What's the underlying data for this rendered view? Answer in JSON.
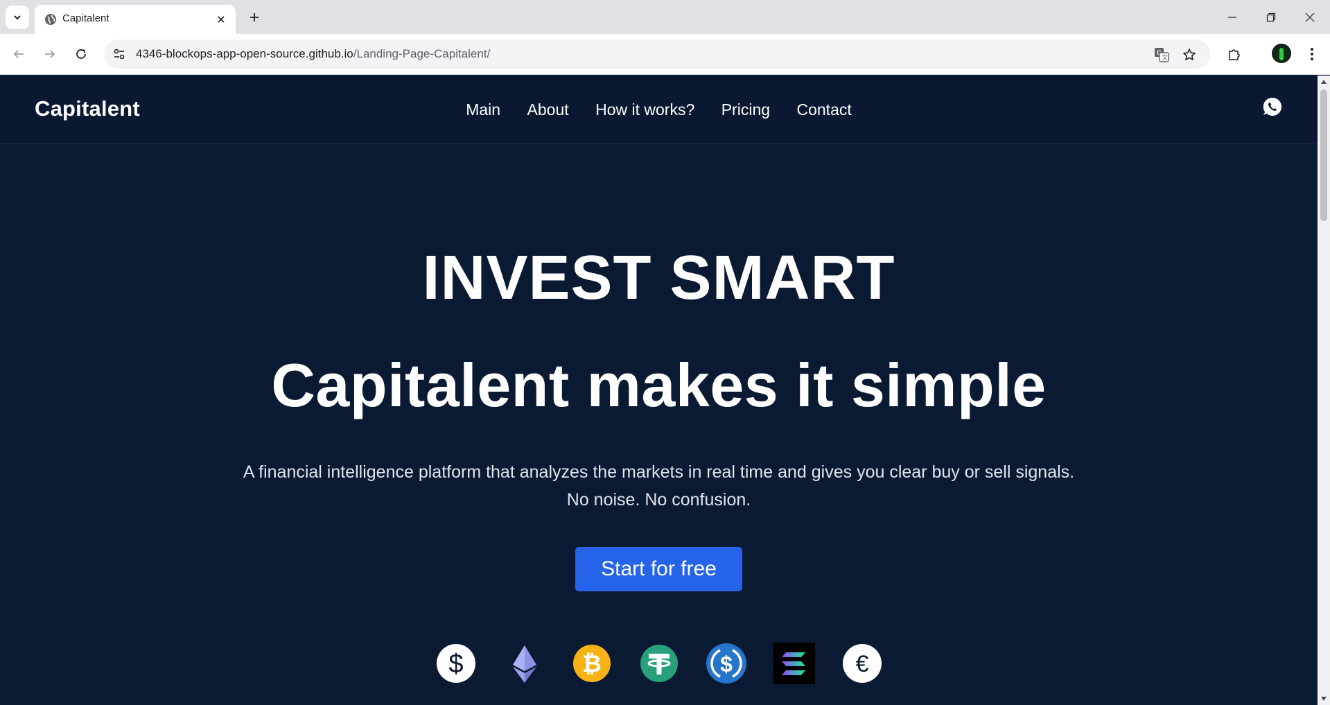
{
  "browser": {
    "tab_title": "Capitalent",
    "url_host": "4346-blockops-app-open-source.github.io",
    "url_path": "/Landing-Page-Capitalent/"
  },
  "header": {
    "brand": "Capitalent",
    "nav": [
      "Main",
      "About",
      "How it works?",
      "Pricing",
      "Contact"
    ]
  },
  "hero": {
    "title": "INVEST SMART",
    "subtitle": "Capitalent makes it simple",
    "description_line1": "A financial intelligence platform that analyzes the markets in real time and gives you clear buy or sell signals.",
    "description_line2": "No noise. No confusion.",
    "cta_label": "Start for free"
  },
  "coins": [
    "dollar-icon",
    "ethereum-icon",
    "bitcoin-icon",
    "tether-icon",
    "usdc-icon",
    "solana-icon",
    "euro-icon"
  ],
  "colors": {
    "page_bg": "#0b1a33",
    "header_bg": "#0a1931",
    "cta": "#2563eb",
    "bitcoin": "#f7b316",
    "tether": "#26a17b",
    "usdc": "#2775ca",
    "ethereum": "#7b87d9"
  }
}
